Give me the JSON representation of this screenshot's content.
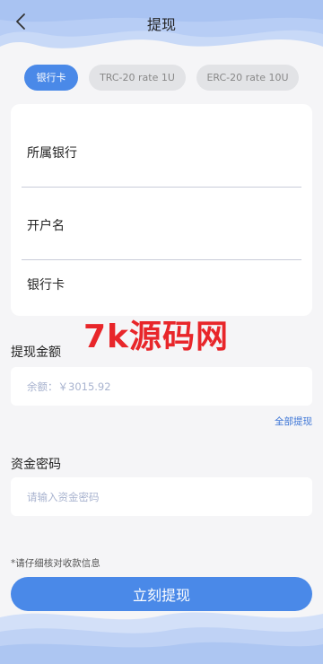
{
  "header": {
    "title": "提现"
  },
  "tabs": [
    {
      "label": "银行卡",
      "active": true
    },
    {
      "label": "TRC-20 rate 1U",
      "active": false
    },
    {
      "label": "ERC-20 rate 10U",
      "active": false
    }
  ],
  "bank_form": {
    "bank_label": "所属银行",
    "name_label": "开户名",
    "card_label": "银行卡"
  },
  "amount": {
    "label": "提现金额",
    "placeholder": "余额：￥3015.92",
    "all_link": "全部提现"
  },
  "password": {
    "label": "资金密码",
    "placeholder": "请输入资金密码"
  },
  "note": "*请仔细核对收款信息",
  "submit_label": "立刻提现",
  "watermark": "7k源码网",
  "colors": {
    "accent": "#4a89e8",
    "watermark": "#e8262a"
  }
}
